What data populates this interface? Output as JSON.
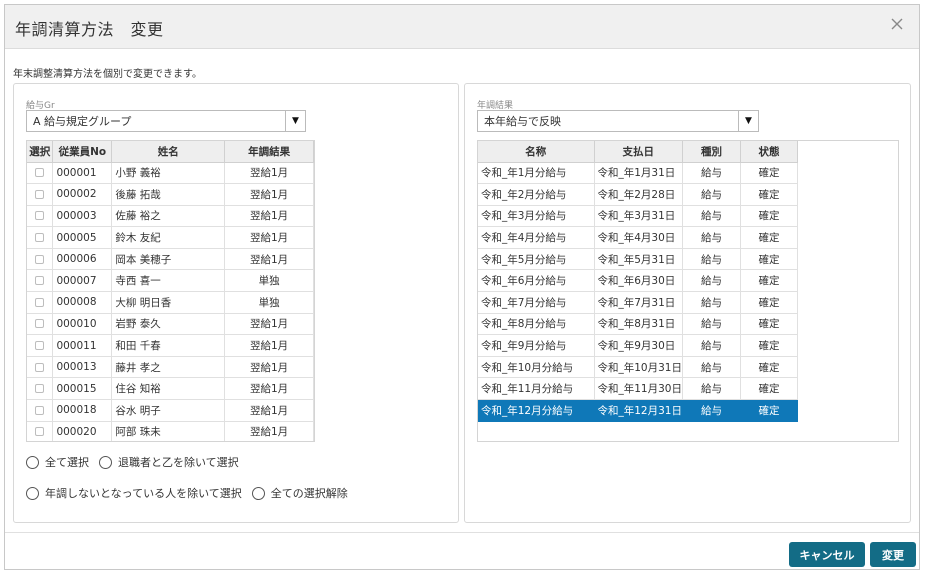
{
  "dialog": {
    "title": "年調清算方法　変更",
    "description": "年末調整清算方法を個別で変更できます。"
  },
  "left": {
    "group_label": "給与Gr",
    "group_value": "A 給与規定グループ",
    "columns": [
      "選択",
      "従業員No",
      "姓名",
      "年調結果"
    ],
    "rows": [
      {
        "no": "000001",
        "name": "小野 義裕",
        "result": "翌給1月"
      },
      {
        "no": "000002",
        "name": "後藤 拓哉",
        "result": "翌給1月"
      },
      {
        "no": "000003",
        "name": "佐藤 裕之",
        "result": "翌給1月"
      },
      {
        "no": "000005",
        "name": "鈴木 友紀",
        "result": "翌給1月"
      },
      {
        "no": "000006",
        "name": "岡本 美穂子",
        "result": "翌給1月"
      },
      {
        "no": "000007",
        "name": "寺西 喜一",
        "result": "単独"
      },
      {
        "no": "000008",
        "name": "大柳 明日香",
        "result": "単独"
      },
      {
        "no": "000010",
        "name": "岩野 泰久",
        "result": "翌給1月"
      },
      {
        "no": "000011",
        "name": "和田 千春",
        "result": "翌給1月"
      },
      {
        "no": "000013",
        "name": "藤井 孝之",
        "result": "翌給1月"
      },
      {
        "no": "000015",
        "name": "住谷 知裕",
        "result": "翌給1月"
      },
      {
        "no": "000018",
        "name": "谷水 明子",
        "result": "翌給1月"
      },
      {
        "no": "000020",
        "name": "阿部 珠未",
        "result": "翌給1月"
      }
    ],
    "radios": [
      "全て選択",
      "退職者と乙を除いて選択",
      "年調しないとなっている人を除いて選択",
      "全ての選択解除"
    ]
  },
  "right": {
    "result_label": "年調結果",
    "result_value": "本年給与で反映",
    "columns": [
      "名称",
      "支払日",
      "種別",
      "状態"
    ],
    "rows": [
      {
        "name": "令和_年1月分給与",
        "date": "令和_年1月31日",
        "type": "給与",
        "state": "確定"
      },
      {
        "name": "令和_年2月分給与",
        "date": "令和_年2月28日",
        "type": "給与",
        "state": "確定"
      },
      {
        "name": "令和_年3月分給与",
        "date": "令和_年3月31日",
        "type": "給与",
        "state": "確定"
      },
      {
        "name": "令和_年4月分給与",
        "date": "令和_年4月30日",
        "type": "給与",
        "state": "確定"
      },
      {
        "name": "令和_年5月分給与",
        "date": "令和_年5月31日",
        "type": "給与",
        "state": "確定"
      },
      {
        "name": "令和_年6月分給与",
        "date": "令和_年6月30日",
        "type": "給与",
        "state": "確定"
      },
      {
        "name": "令和_年7月分給与",
        "date": "令和_年7月31日",
        "type": "給与",
        "state": "確定"
      },
      {
        "name": "令和_年8月分給与",
        "date": "令和_年8月31日",
        "type": "給与",
        "state": "確定"
      },
      {
        "name": "令和_年9月分給与",
        "date": "令和_年9月30日",
        "type": "給与",
        "state": "確定"
      },
      {
        "name": "令和_年10月分給与",
        "date": "令和_年10月31日",
        "type": "給与",
        "state": "確定"
      },
      {
        "name": "令和_年11月分給与",
        "date": "令和_年11月30日",
        "type": "給与",
        "state": "確定"
      },
      {
        "name": "令和_年12月分給与",
        "date": "令和_年12月31日",
        "type": "給与",
        "state": "確定"
      }
    ],
    "selected_index": 11
  },
  "buttons": {
    "cancel": "キャンセル",
    "ok": "変更"
  },
  "colors": {
    "selected_row": "#0f78b8",
    "button": "#136c86"
  },
  "icons": {
    "close": "close-icon",
    "dropdown": "dropdown-arrow-icon"
  }
}
